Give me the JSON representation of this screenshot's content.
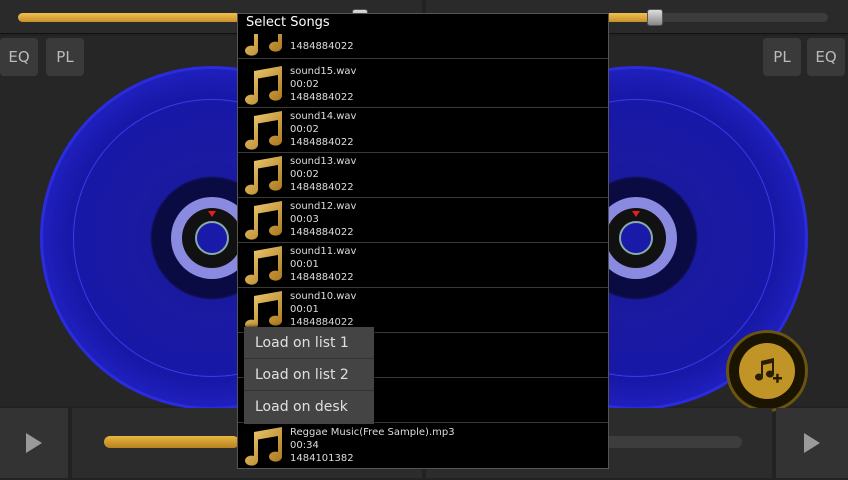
{
  "colors": {
    "accent": "#e8b640",
    "platter": "#1818a8",
    "dialog_bg": "#000000",
    "menu_bg": "#444444"
  },
  "decks": {
    "left": {
      "eq_label": "EQ",
      "pl_label": "PL",
      "volume_fraction": 0.9,
      "progress_fraction": 0.45
    },
    "right": {
      "eq_label": "EQ",
      "pl_label": "PL",
      "volume_fraction": 0.55,
      "progress_fraction": 0.0
    }
  },
  "icons": {
    "play": "play-icon",
    "note": "music-note-icon",
    "add_music": "add-music-icon"
  },
  "dialog": {
    "title": "Select Songs",
    "songs": [
      {
        "name": "",
        "duration": "",
        "date": "1484884022"
      },
      {
        "name": "sound15.wav",
        "duration": "00:02",
        "date": "1484884022"
      },
      {
        "name": "sound14.wav",
        "duration": "00:02",
        "date": "1484884022"
      },
      {
        "name": "sound13.wav",
        "duration": "00:02",
        "date": "1484884022"
      },
      {
        "name": "sound12.wav",
        "duration": "00:03",
        "date": "1484884022"
      },
      {
        "name": "sound11.wav",
        "duration": "00:01",
        "date": "1484884022"
      },
      {
        "name": "sound10.wav",
        "duration": "00:01",
        "date": "1484884022"
      },
      {
        "name": "",
        "duration": "",
        "date": ""
      },
      {
        "name": "",
        "duration": "",
        "date": ""
      },
      {
        "name": "Reggae Music(Free Sample).mp3",
        "duration": "00:34",
        "date": "1484101382"
      }
    ]
  },
  "popup_menu": {
    "items": [
      "Load on list 1",
      "Load on list 2",
      "Load on desk"
    ]
  }
}
